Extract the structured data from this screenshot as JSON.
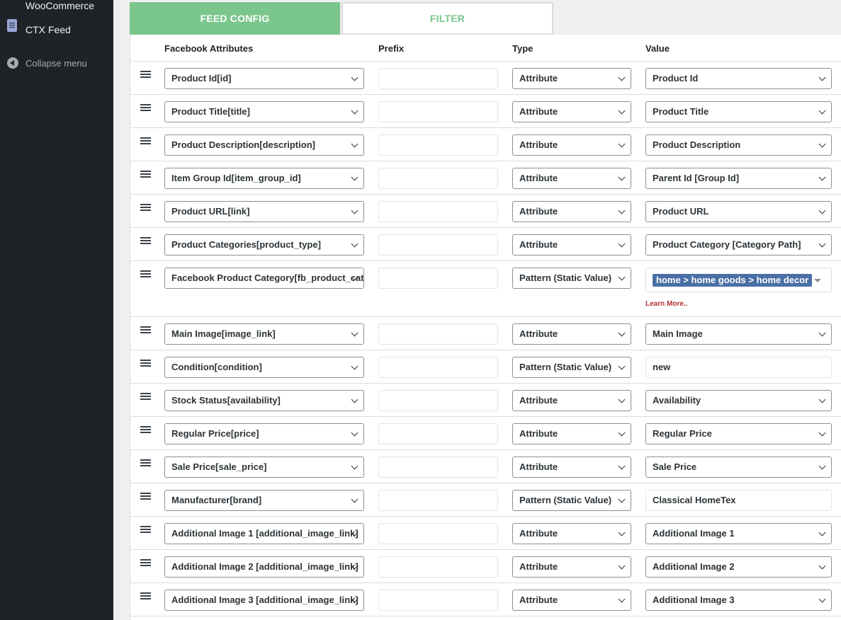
{
  "sidebar": {
    "woocommerce": "WooCommerce",
    "ctx_feed": "CTX Feed",
    "collapse": "Collapse menu"
  },
  "tabs": {
    "feed_config": "FEED CONFIG",
    "filter": "FILTER"
  },
  "table": {
    "headers": {
      "attribute": "Facebook Attributes",
      "prefix": "Prefix",
      "type": "Type",
      "value": "Value"
    },
    "rows": [
      {
        "attribute": "Product Id[id]",
        "prefix": "",
        "type": "Attribute",
        "value": "Product Id"
      },
      {
        "attribute": "Product Title[title]",
        "prefix": "",
        "type": "Attribute",
        "value": "Product Title"
      },
      {
        "attribute": "Product Description[description]",
        "prefix": "",
        "type": "Attribute",
        "value": "Product Description"
      },
      {
        "attribute": "Item Group Id[item_group_id]",
        "prefix": "",
        "type": "Attribute",
        "value": "Parent Id [Group Id]"
      },
      {
        "attribute": "Product URL[link]",
        "prefix": "",
        "type": "Attribute",
        "value": "Product URL"
      },
      {
        "attribute": "Product Categories[product_type]",
        "prefix": "",
        "type": "Attribute",
        "value": "Product Category [Category Path]"
      },
      {
        "attribute": "Facebook Product Category[fb_product_category]",
        "prefix": "",
        "type": "Pattern (Static Value)",
        "value": "home > home goods > home decor",
        "learn_more": "Learn More.."
      },
      {
        "attribute": "Main Image[image_link]",
        "prefix": "",
        "type": "Attribute",
        "value": "Main Image"
      },
      {
        "attribute": "Condition[condition]",
        "prefix": "",
        "type": "Pattern (Static Value)",
        "value": "new"
      },
      {
        "attribute": "Stock Status[availability]",
        "prefix": "",
        "type": "Attribute",
        "value": "Availability"
      },
      {
        "attribute": "Regular Price[price]",
        "prefix": "",
        "type": "Attribute",
        "value": "Regular Price"
      },
      {
        "attribute": "Sale Price[sale_price]",
        "prefix": "",
        "type": "Attribute",
        "value": "Sale Price"
      },
      {
        "attribute": "Manufacturer[brand]",
        "prefix": "",
        "type": "Pattern (Static Value)",
        "value": "Classical HomeTex"
      },
      {
        "attribute": "Additional Image 1 [additional_image_link]",
        "prefix": "",
        "type": "Attribute",
        "value": "Additional Image 1"
      },
      {
        "attribute": "Additional Image 2 [additional_image_link]",
        "prefix": "",
        "type": "Attribute",
        "value": "Additional Image 2"
      },
      {
        "attribute": "Additional Image 3 [additional_image_link]",
        "prefix": "",
        "type": "Attribute",
        "value": "Additional Image 3"
      }
    ]
  },
  "colors": {
    "active_tab": "#7bc68c",
    "sidebar": "#1d2327",
    "tag": "#4a6fa5",
    "learn_more": "#b32d2e"
  }
}
